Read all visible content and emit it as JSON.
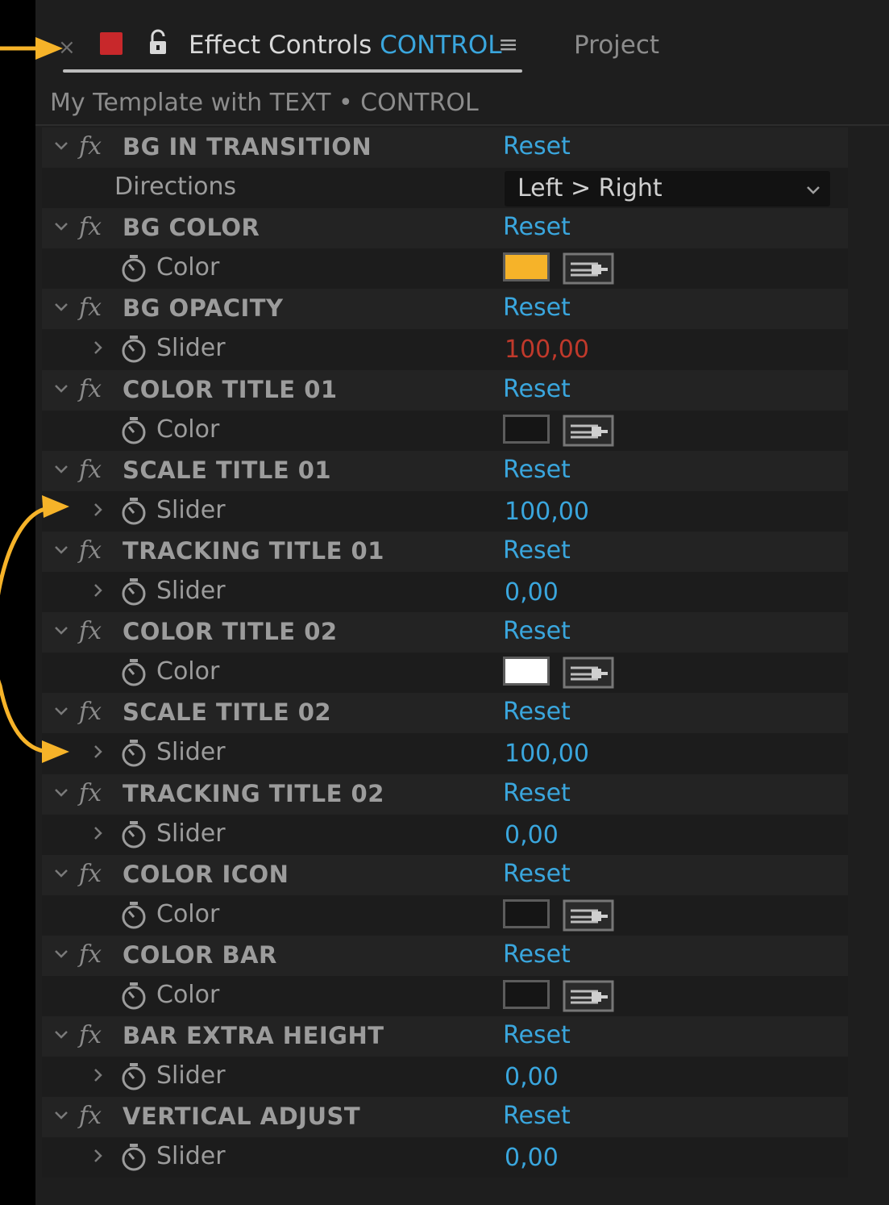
{
  "panel": {
    "active_tab": {
      "title": "Effect Controls",
      "layer": "CONTROL",
      "label_color": "#c8282b"
    },
    "other_tab": "Project",
    "breadcrumb": "My Template with TEXT • CONTROL",
    "accent_color": "#3aa6dd"
  },
  "effects": [
    {
      "name": "BG IN TRANSITION",
      "reset": "Reset",
      "prop": {
        "kind": "dropdown",
        "label": "Directions",
        "value": "Left > Right"
      }
    },
    {
      "name": "BG COLOR",
      "reset": "Reset",
      "prop": {
        "kind": "color",
        "label": "Color",
        "color": "#f6b329"
      }
    },
    {
      "name": "BG OPACITY",
      "reset": "Reset",
      "prop": {
        "kind": "slider",
        "label": "Slider",
        "value": "100,00",
        "value_color": "#c0392b"
      }
    },
    {
      "name": "COLOR TITLE 01",
      "reset": "Reset",
      "prop": {
        "kind": "color",
        "label": "Color",
        "color": "#151515"
      }
    },
    {
      "name": "SCALE TITLE 01",
      "reset": "Reset",
      "prop": {
        "kind": "slider",
        "label": "Slider",
        "value": "100,00"
      }
    },
    {
      "name": "TRACKING TITLE 01",
      "reset": "Reset",
      "prop": {
        "kind": "slider",
        "label": "Slider",
        "value": "0,00"
      }
    },
    {
      "name": "COLOR TITLE 02",
      "reset": "Reset",
      "prop": {
        "kind": "color",
        "label": "Color",
        "color": "#ffffff"
      }
    },
    {
      "name": "SCALE TITLE 02",
      "reset": "Reset",
      "prop": {
        "kind": "slider",
        "label": "Slider",
        "value": "100,00"
      }
    },
    {
      "name": "TRACKING TITLE 02",
      "reset": "Reset",
      "prop": {
        "kind": "slider",
        "label": "Slider",
        "value": "0,00"
      }
    },
    {
      "name": "COLOR ICON",
      "reset": "Reset",
      "prop": {
        "kind": "color",
        "label": "Color",
        "color": "#151515"
      }
    },
    {
      "name": "COLOR BAR",
      "reset": "Reset",
      "prop": {
        "kind": "color",
        "label": "Color",
        "color": "#151515"
      }
    },
    {
      "name": "BAR EXTRA HEIGHT",
      "reset": "Reset",
      "prop": {
        "kind": "slider",
        "label": "Slider",
        "value": "0,00"
      }
    },
    {
      "name": "VERTICAL ADJUST",
      "reset": "Reset",
      "prop": {
        "kind": "slider",
        "label": "Slider",
        "value": "0,00"
      }
    }
  ],
  "annotations": {
    "arrow_color": "#f6b329"
  }
}
